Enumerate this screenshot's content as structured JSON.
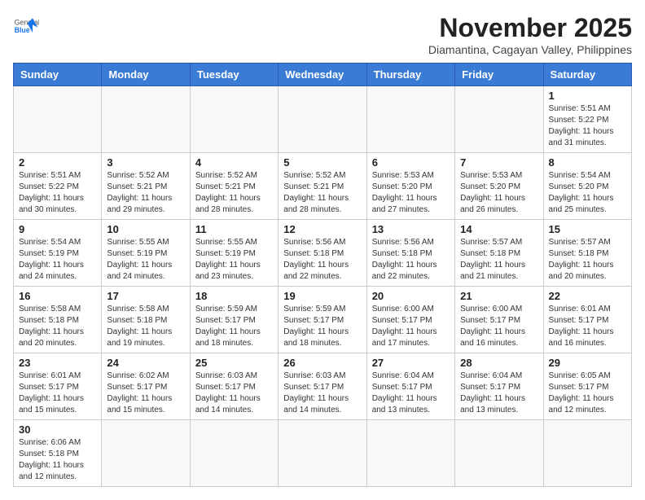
{
  "header": {
    "logo_general": "General",
    "logo_blue": "Blue",
    "month_title": "November 2025",
    "location": "Diamantina, Cagayan Valley, Philippines"
  },
  "weekdays": [
    "Sunday",
    "Monday",
    "Tuesday",
    "Wednesday",
    "Thursday",
    "Friday",
    "Saturday"
  ],
  "weeks": [
    [
      {
        "day": "",
        "info": ""
      },
      {
        "day": "",
        "info": ""
      },
      {
        "day": "",
        "info": ""
      },
      {
        "day": "",
        "info": ""
      },
      {
        "day": "",
        "info": ""
      },
      {
        "day": "",
        "info": ""
      },
      {
        "day": "1",
        "info": "Sunrise: 5:51 AM\nSunset: 5:22 PM\nDaylight: 11 hours and 31 minutes."
      }
    ],
    [
      {
        "day": "2",
        "info": "Sunrise: 5:51 AM\nSunset: 5:22 PM\nDaylight: 11 hours and 30 minutes."
      },
      {
        "day": "3",
        "info": "Sunrise: 5:52 AM\nSunset: 5:21 PM\nDaylight: 11 hours and 29 minutes."
      },
      {
        "day": "4",
        "info": "Sunrise: 5:52 AM\nSunset: 5:21 PM\nDaylight: 11 hours and 28 minutes."
      },
      {
        "day": "5",
        "info": "Sunrise: 5:52 AM\nSunset: 5:21 PM\nDaylight: 11 hours and 28 minutes."
      },
      {
        "day": "6",
        "info": "Sunrise: 5:53 AM\nSunset: 5:20 PM\nDaylight: 11 hours and 27 minutes."
      },
      {
        "day": "7",
        "info": "Sunrise: 5:53 AM\nSunset: 5:20 PM\nDaylight: 11 hours and 26 minutes."
      },
      {
        "day": "8",
        "info": "Sunrise: 5:54 AM\nSunset: 5:20 PM\nDaylight: 11 hours and 25 minutes."
      }
    ],
    [
      {
        "day": "9",
        "info": "Sunrise: 5:54 AM\nSunset: 5:19 PM\nDaylight: 11 hours and 24 minutes."
      },
      {
        "day": "10",
        "info": "Sunrise: 5:55 AM\nSunset: 5:19 PM\nDaylight: 11 hours and 24 minutes."
      },
      {
        "day": "11",
        "info": "Sunrise: 5:55 AM\nSunset: 5:19 PM\nDaylight: 11 hours and 23 minutes."
      },
      {
        "day": "12",
        "info": "Sunrise: 5:56 AM\nSunset: 5:18 PM\nDaylight: 11 hours and 22 minutes."
      },
      {
        "day": "13",
        "info": "Sunrise: 5:56 AM\nSunset: 5:18 PM\nDaylight: 11 hours and 22 minutes."
      },
      {
        "day": "14",
        "info": "Sunrise: 5:57 AM\nSunset: 5:18 PM\nDaylight: 11 hours and 21 minutes."
      },
      {
        "day": "15",
        "info": "Sunrise: 5:57 AM\nSunset: 5:18 PM\nDaylight: 11 hours and 20 minutes."
      }
    ],
    [
      {
        "day": "16",
        "info": "Sunrise: 5:58 AM\nSunset: 5:18 PM\nDaylight: 11 hours and 20 minutes."
      },
      {
        "day": "17",
        "info": "Sunrise: 5:58 AM\nSunset: 5:18 PM\nDaylight: 11 hours and 19 minutes."
      },
      {
        "day": "18",
        "info": "Sunrise: 5:59 AM\nSunset: 5:17 PM\nDaylight: 11 hours and 18 minutes."
      },
      {
        "day": "19",
        "info": "Sunrise: 5:59 AM\nSunset: 5:17 PM\nDaylight: 11 hours and 18 minutes."
      },
      {
        "day": "20",
        "info": "Sunrise: 6:00 AM\nSunset: 5:17 PM\nDaylight: 11 hours and 17 minutes."
      },
      {
        "day": "21",
        "info": "Sunrise: 6:00 AM\nSunset: 5:17 PM\nDaylight: 11 hours and 16 minutes."
      },
      {
        "day": "22",
        "info": "Sunrise: 6:01 AM\nSunset: 5:17 PM\nDaylight: 11 hours and 16 minutes."
      }
    ],
    [
      {
        "day": "23",
        "info": "Sunrise: 6:01 AM\nSunset: 5:17 PM\nDaylight: 11 hours and 15 minutes."
      },
      {
        "day": "24",
        "info": "Sunrise: 6:02 AM\nSunset: 5:17 PM\nDaylight: 11 hours and 15 minutes."
      },
      {
        "day": "25",
        "info": "Sunrise: 6:03 AM\nSunset: 5:17 PM\nDaylight: 11 hours and 14 minutes."
      },
      {
        "day": "26",
        "info": "Sunrise: 6:03 AM\nSunset: 5:17 PM\nDaylight: 11 hours and 14 minutes."
      },
      {
        "day": "27",
        "info": "Sunrise: 6:04 AM\nSunset: 5:17 PM\nDaylight: 11 hours and 13 minutes."
      },
      {
        "day": "28",
        "info": "Sunrise: 6:04 AM\nSunset: 5:17 PM\nDaylight: 11 hours and 13 minutes."
      },
      {
        "day": "29",
        "info": "Sunrise: 6:05 AM\nSunset: 5:17 PM\nDaylight: 11 hours and 12 minutes."
      }
    ],
    [
      {
        "day": "30",
        "info": "Sunrise: 6:06 AM\nSunset: 5:18 PM\nDaylight: 11 hours and 12 minutes."
      },
      {
        "day": "",
        "info": ""
      },
      {
        "day": "",
        "info": ""
      },
      {
        "day": "",
        "info": ""
      },
      {
        "day": "",
        "info": ""
      },
      {
        "day": "",
        "info": ""
      },
      {
        "day": "",
        "info": ""
      }
    ]
  ]
}
